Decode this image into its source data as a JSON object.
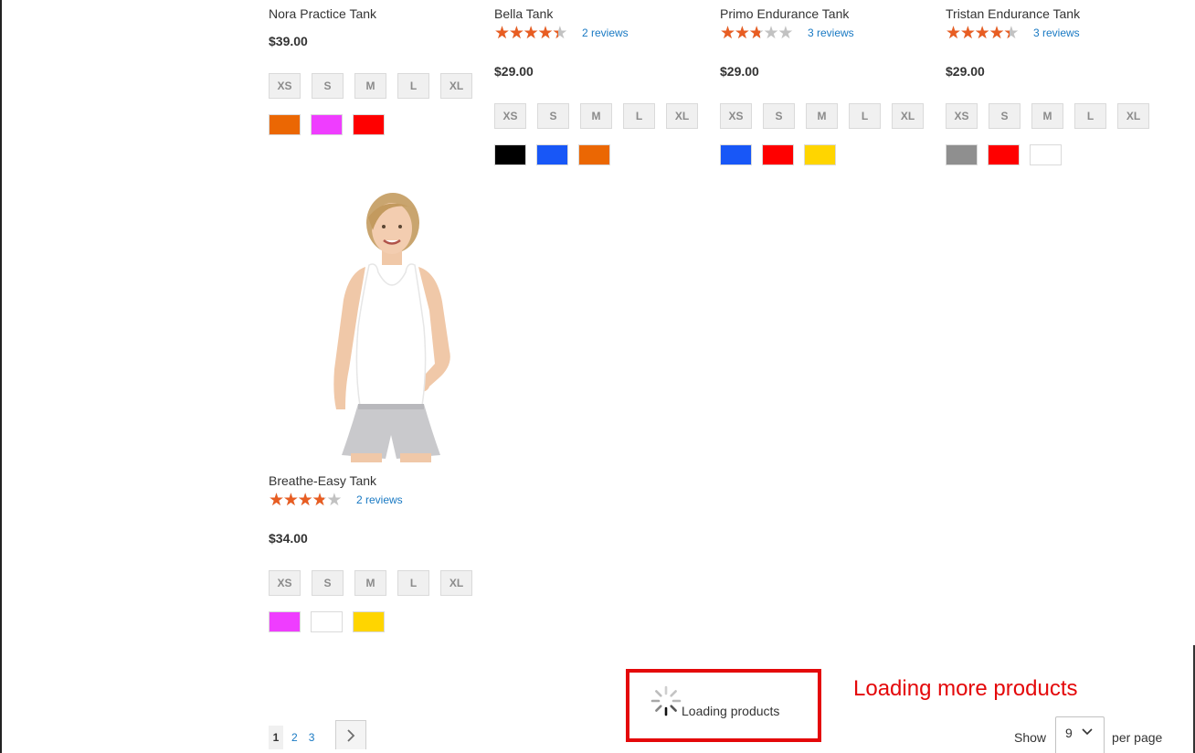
{
  "products": [
    {
      "name": "Nora Practice Tank",
      "rating_percent": null,
      "reviews": "",
      "price": "$39.00",
      "sizes": [
        "XS",
        "S",
        "M",
        "L",
        "XL"
      ],
      "colors": [
        "#eb6703",
        "#ef3dff",
        "#ff0000"
      ]
    },
    {
      "name": "Bella Tank",
      "rating_percent": 80,
      "reviews": "2 reviews",
      "price": "$29.00",
      "sizes": [
        "XS",
        "S",
        "M",
        "L",
        "XL"
      ],
      "colors": [
        "#000000",
        "#1857f7",
        "#eb6703"
      ]
    },
    {
      "name": "Primo Endurance Tank",
      "rating_percent": 50,
      "reviews": "3 reviews",
      "price": "$29.00",
      "sizes": [
        "XS",
        "S",
        "M",
        "L",
        "XL"
      ],
      "colors": [
        "#1857f7",
        "#ff0000",
        "#ffd500"
      ]
    },
    {
      "name": "Tristan Endurance Tank",
      "rating_percent": 80,
      "reviews": "3 reviews",
      "price": "$29.00",
      "sizes": [
        "XS",
        "S",
        "M",
        "L",
        "XL"
      ],
      "colors": [
        "#8f8f8f",
        "#ff0000",
        "#ffffff"
      ]
    },
    {
      "name": "Breathe-Easy Tank",
      "rating_percent": 70,
      "reviews": "2 reviews",
      "price": "$34.00",
      "sizes": [
        "XS",
        "S",
        "M",
        "L",
        "XL"
      ],
      "colors": [
        "#ef3dff",
        "#ffffff",
        "#ffd500"
      ]
    }
  ],
  "pagination": {
    "pages": [
      "1",
      "2",
      "3"
    ],
    "current": "1",
    "next_icon": "chevron-right-icon"
  },
  "loader": {
    "text": "Loading products",
    "icon": "spinner-icon"
  },
  "annotation": {
    "text": "Loading more products",
    "color": "#e4080a"
  },
  "limiter": {
    "label_before": "Show",
    "value": "9",
    "label_after": "per page"
  },
  "colors": {
    "star": "#e85d22",
    "star_empty": "#c2c2c2",
    "link": "#1979c3"
  }
}
